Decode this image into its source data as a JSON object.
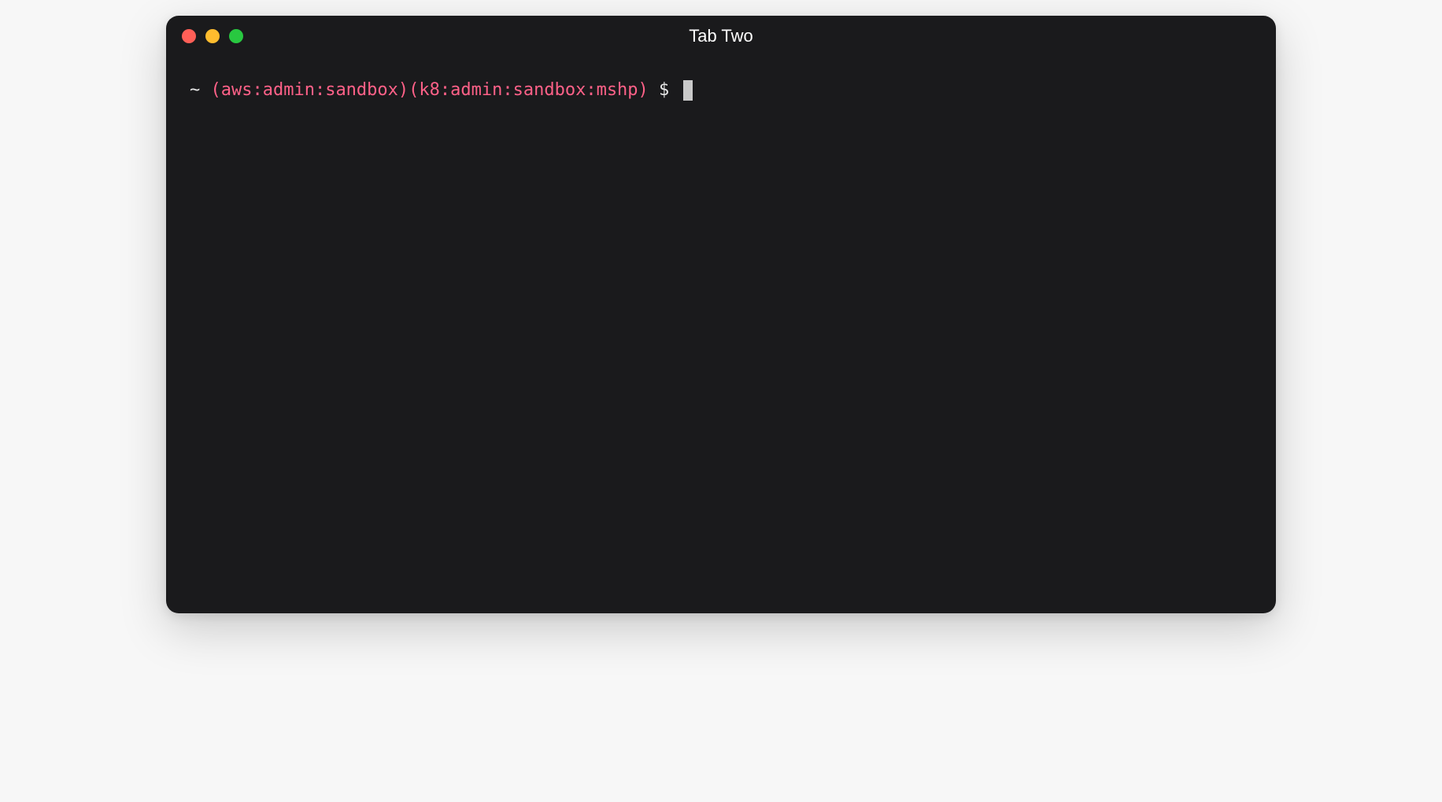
{
  "window": {
    "title": "Tab Two"
  },
  "traffic_lights": {
    "close": "close-icon",
    "minimize": "minimize-icon",
    "maximize": "maximize-icon"
  },
  "prompt": {
    "cwd": "~ ",
    "context": "(aws:admin:sandbox)(k8:admin:sandbox:mshp)",
    "symbol": " $ ",
    "input": ""
  }
}
